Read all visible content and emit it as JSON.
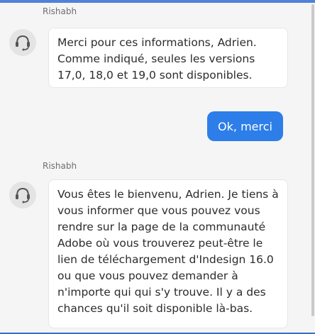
{
  "messages": [
    {
      "sender": "Rishabh",
      "avatar_icon": "headset-agent-icon",
      "text": "Merci pour ces informations, Adrien. Comme indiqué, seules les versions 17,0, 18,0 et 19,0 sont disponibles."
    },
    {
      "reply": "Ok, merci"
    },
    {
      "sender": "Rishabh",
      "avatar_icon": "headset-agent-icon",
      "text": "Vous êtes le bienvenu, Adrien. Je tiens à vous informer que vous pouvez vous rendre sur la page de la communauté Adobe où vous trouverez peut-être le lien de téléchargement d'Indesign 16.0 ou que vous pouvez demander à n'importe qui qui s'y trouve. Il y a des chances qu'il soit disponible là-bas."
    }
  ],
  "colors": {
    "accent": "#2d7ee8",
    "frame": "#4f83d8",
    "background": "#f5f5f5",
    "bubble": "#ffffff"
  }
}
